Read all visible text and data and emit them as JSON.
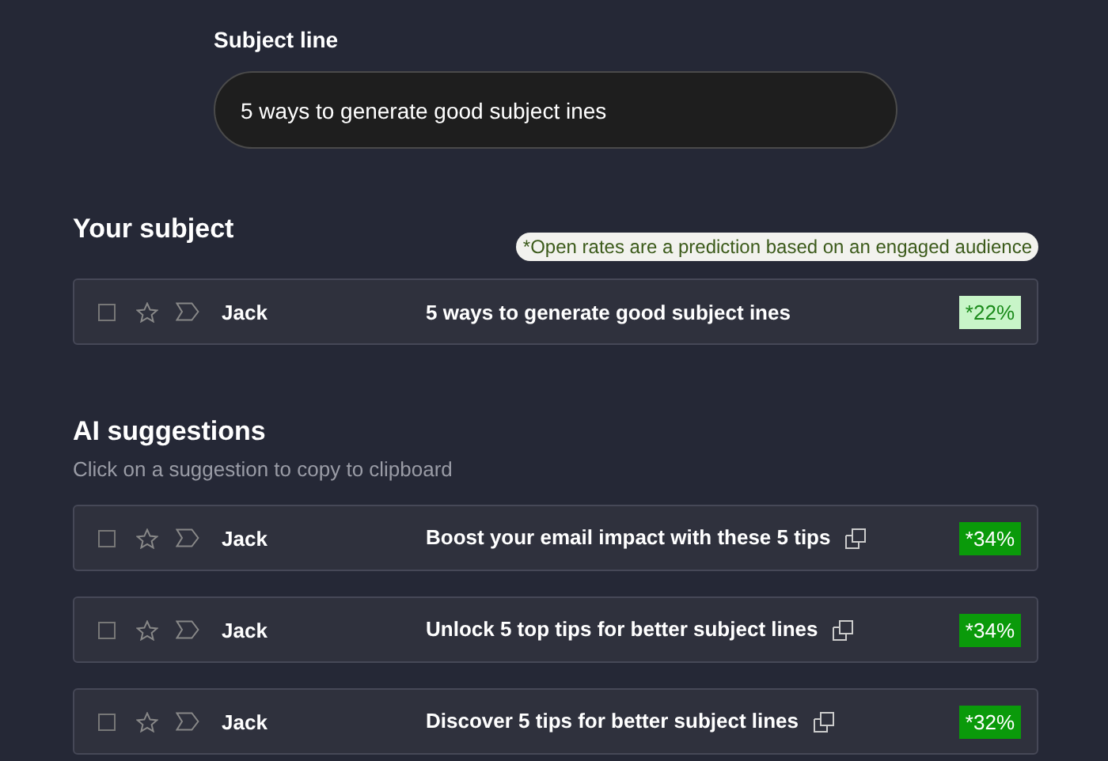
{
  "subject_field": {
    "label": "Subject line",
    "value": "5 ways to generate good subject ines"
  },
  "your_subject": {
    "heading": "Your subject",
    "note": "*Open rates are a prediction based on an engaged audience",
    "rows": [
      {
        "kind": "current",
        "checked": false,
        "starred": false,
        "sender": "Jack",
        "subject": "5 ways to generate good subject ines",
        "copyable": false,
        "rate": "*22%"
      }
    ]
  },
  "ai_suggestions": {
    "heading": "AI suggestions",
    "hint": "Click on a suggestion to copy to clipboard",
    "rows": [
      {
        "kind": "suggestion",
        "checked": false,
        "starred": false,
        "sender": "Jack",
        "subject": "Boost your email impact with these 5 tips",
        "copyable": true,
        "rate": "*34%"
      },
      {
        "kind": "suggestion",
        "checked": false,
        "starred": false,
        "sender": "Jack",
        "subject": "Unlock 5 top tips for better subject lines",
        "copyable": true,
        "rate": "*34%"
      },
      {
        "kind": "suggestion",
        "checked": false,
        "starred": false,
        "sender": "Jack",
        "subject": "Discover 5 tips for better subject lines",
        "copyable": true,
        "rate": "*32%"
      }
    ]
  }
}
